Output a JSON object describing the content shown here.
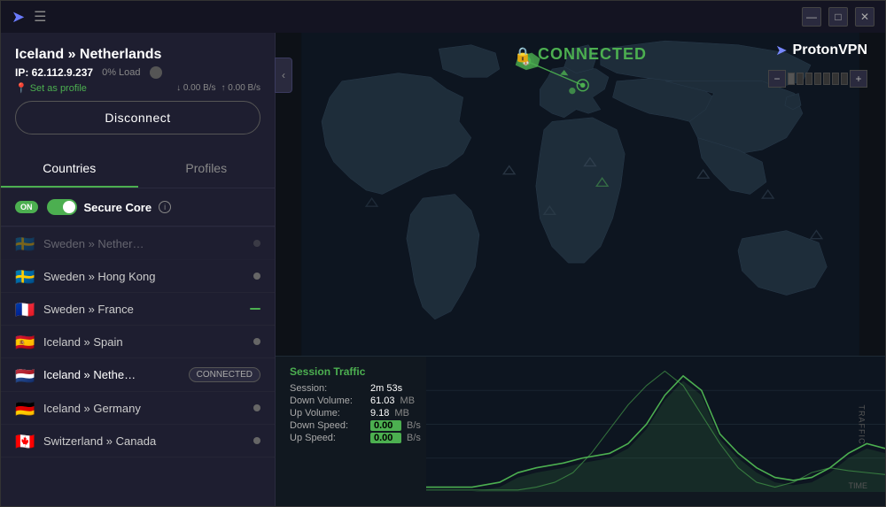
{
  "titleBar": {
    "minimizeLabel": "—",
    "maximizeLabel": "□",
    "closeLabel": "✕"
  },
  "connectionInfo": {
    "serverName": "Iceland » Netherlands",
    "ip": "IP: 62.112.9.237",
    "load": "0% Load",
    "setAsProfile": "Set as profile",
    "downSpeed": "↓ 0.00 B/s",
    "upSpeed": "↑ 0.00 B/s",
    "disconnectLabel": "Disconnect"
  },
  "tabs": {
    "countries": "Countries",
    "profiles": "Profiles"
  },
  "secureCore": {
    "toggleLabel": "ON",
    "label": "Secure Core",
    "infoTooltip": "i"
  },
  "serverList": [
    {
      "flag": "🇸🇪",
      "name": "Sweden » Hong Kong",
      "connected": false
    },
    {
      "flag": "🇫🇷",
      "name": "Sweden » France",
      "connected": false,
      "indicator": "minus"
    },
    {
      "flag": "🇪🇸",
      "name": "Iceland » Spain",
      "connected": false
    },
    {
      "flag": "🇳🇱",
      "name": "Iceland » Nethe…",
      "connected": true,
      "badge": "CONNECTED"
    },
    {
      "flag": "🇩🇪",
      "name": "Iceland » Germany",
      "connected": false
    },
    {
      "flag": "🇨🇦",
      "name": "Switzerland » Canada",
      "connected": false
    }
  ],
  "map": {
    "connectedStatus": "CONNECTED",
    "brandName": "ProtonVPN",
    "zoomMinus": "−",
    "zoomPlus": "+"
  },
  "traffic": {
    "title": "Session Traffic",
    "stats": [
      {
        "label": "Session:",
        "value": "2m 53s",
        "unit": ""
      },
      {
        "label": "Down Volume:",
        "value": "61.03",
        "unit": "MB"
      },
      {
        "label": "Up Volume:",
        "value": "9.18",
        "unit": "MB"
      },
      {
        "label": "Down Speed:",
        "value": "0.00",
        "unit": "B/s",
        "highlight": true
      },
      {
        "label": "Up Speed:",
        "value": "0.00",
        "unit": "B/s",
        "highlight": true
      }
    ],
    "verticalLabel": "TRAFFIC",
    "timeLabel": "TIME"
  }
}
